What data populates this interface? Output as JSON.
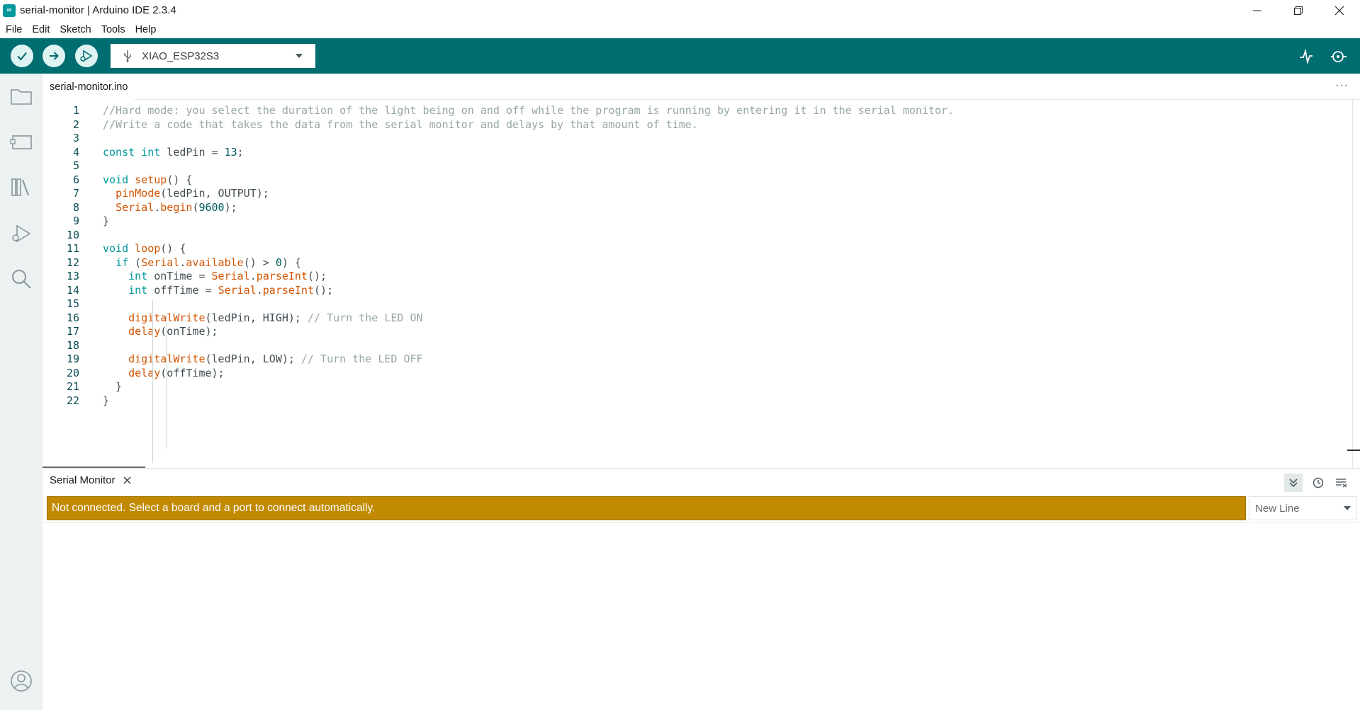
{
  "window": {
    "title": "serial-monitor | Arduino IDE 2.3.4",
    "app_icon_glyph": "∞"
  },
  "menu": [
    "File",
    "Edit",
    "Sketch",
    "Tools",
    "Help"
  ],
  "toolbar": {
    "board": "XIAO_ESP32S3"
  },
  "editor": {
    "tab_label": "serial-monitor.ino",
    "more_label": "···",
    "lines": [
      {
        "n": "1",
        "tokens": [
          {
            "t": "//Hard mode: you select the duration of the light being on and off while the program is running by entering it in the serial monitor.",
            "c": "cm"
          }
        ]
      },
      {
        "n": "2",
        "tokens": [
          {
            "t": "//Write a code that takes the data from the serial monitor and delays by that amount of time.",
            "c": "cm"
          }
        ]
      },
      {
        "n": "3",
        "tokens": []
      },
      {
        "n": "4",
        "tokens": [
          {
            "t": "const",
            "c": "kw"
          },
          {
            "t": " "
          },
          {
            "t": "int",
            "c": "kw"
          },
          {
            "t": " ledPin = "
          },
          {
            "t": "13",
            "c": "num"
          },
          {
            "t": ";"
          }
        ]
      },
      {
        "n": "5",
        "tokens": []
      },
      {
        "n": "6",
        "tokens": [
          {
            "t": "void",
            "c": "kw"
          },
          {
            "t": " "
          },
          {
            "t": "setup",
            "c": "fn"
          },
          {
            "t": "() {"
          }
        ]
      },
      {
        "n": "7",
        "tokens": [
          {
            "t": "  "
          },
          {
            "t": "pinMode",
            "c": "fn"
          },
          {
            "t": "(ledPin, OUTPUT);"
          }
        ]
      },
      {
        "n": "8",
        "tokens": [
          {
            "t": "  "
          },
          {
            "t": "Serial",
            "c": "fn"
          },
          {
            "t": "."
          },
          {
            "t": "begin",
            "c": "fn"
          },
          {
            "t": "("
          },
          {
            "t": "9600",
            "c": "num"
          },
          {
            "t": ");"
          }
        ]
      },
      {
        "n": "9",
        "tokens": [
          {
            "t": "}"
          }
        ]
      },
      {
        "n": "10",
        "tokens": []
      },
      {
        "n": "11",
        "tokens": [
          {
            "t": "void",
            "c": "kw"
          },
          {
            "t": " "
          },
          {
            "t": "loop",
            "c": "fn"
          },
          {
            "t": "() {"
          }
        ]
      },
      {
        "n": "12",
        "tokens": [
          {
            "t": "  "
          },
          {
            "t": "if",
            "c": "kw"
          },
          {
            "t": " ("
          },
          {
            "t": "Serial",
            "c": "fn"
          },
          {
            "t": "."
          },
          {
            "t": "available",
            "c": "fn"
          },
          {
            "t": "() > "
          },
          {
            "t": "0",
            "c": "num"
          },
          {
            "t": ") {"
          }
        ]
      },
      {
        "n": "13",
        "tokens": [
          {
            "t": "    "
          },
          {
            "t": "int",
            "c": "kw"
          },
          {
            "t": " onTime = "
          },
          {
            "t": "Serial",
            "c": "fn"
          },
          {
            "t": "."
          },
          {
            "t": "parseInt",
            "c": "fn"
          },
          {
            "t": "();"
          }
        ]
      },
      {
        "n": "14",
        "tokens": [
          {
            "t": "    "
          },
          {
            "t": "int",
            "c": "kw"
          },
          {
            "t": " offTime = "
          },
          {
            "t": "Serial",
            "c": "fn"
          },
          {
            "t": "."
          },
          {
            "t": "parseInt",
            "c": "fn"
          },
          {
            "t": "();"
          }
        ]
      },
      {
        "n": "15",
        "tokens": []
      },
      {
        "n": "16",
        "tokens": [
          {
            "t": "    "
          },
          {
            "t": "digitalWrite",
            "c": "fn"
          },
          {
            "t": "(ledPin, HIGH); "
          },
          {
            "t": "// Turn the LED ON",
            "c": "cm"
          }
        ]
      },
      {
        "n": "17",
        "tokens": [
          {
            "t": "    "
          },
          {
            "t": "delay",
            "c": "fn"
          },
          {
            "t": "(onTime);"
          }
        ]
      },
      {
        "n": "18",
        "tokens": []
      },
      {
        "n": "19",
        "tokens": [
          {
            "t": "    "
          },
          {
            "t": "digitalWrite",
            "c": "fn"
          },
          {
            "t": "(ledPin, LOW); "
          },
          {
            "t": "// Turn the LED OFF",
            "c": "cm"
          }
        ]
      },
      {
        "n": "20",
        "tokens": [
          {
            "t": "    "
          },
          {
            "t": "delay",
            "c": "fn"
          },
          {
            "t": "(offTime);"
          }
        ]
      },
      {
        "n": "21",
        "tokens": [
          {
            "t": "  }"
          }
        ]
      },
      {
        "n": "22",
        "tokens": [
          {
            "t": "}"
          }
        ]
      }
    ]
  },
  "panel": {
    "tab_label": "Serial Monitor",
    "notice": "Not connected. Select a board and a port to connect automatically.",
    "line_ending": "New Line"
  },
  "colors": {
    "toolbar": "#006d70",
    "notice": "#c18a00",
    "keyword": "#00979d",
    "function": "#d35400",
    "comment": "#95a5a6"
  },
  "icons": {
    "verify": "check-icon",
    "upload": "arrow-right-icon",
    "debug": "debug-icon",
    "serial_plotter": "plotter-icon",
    "serial_monitor": "serial-monitor-icon"
  }
}
